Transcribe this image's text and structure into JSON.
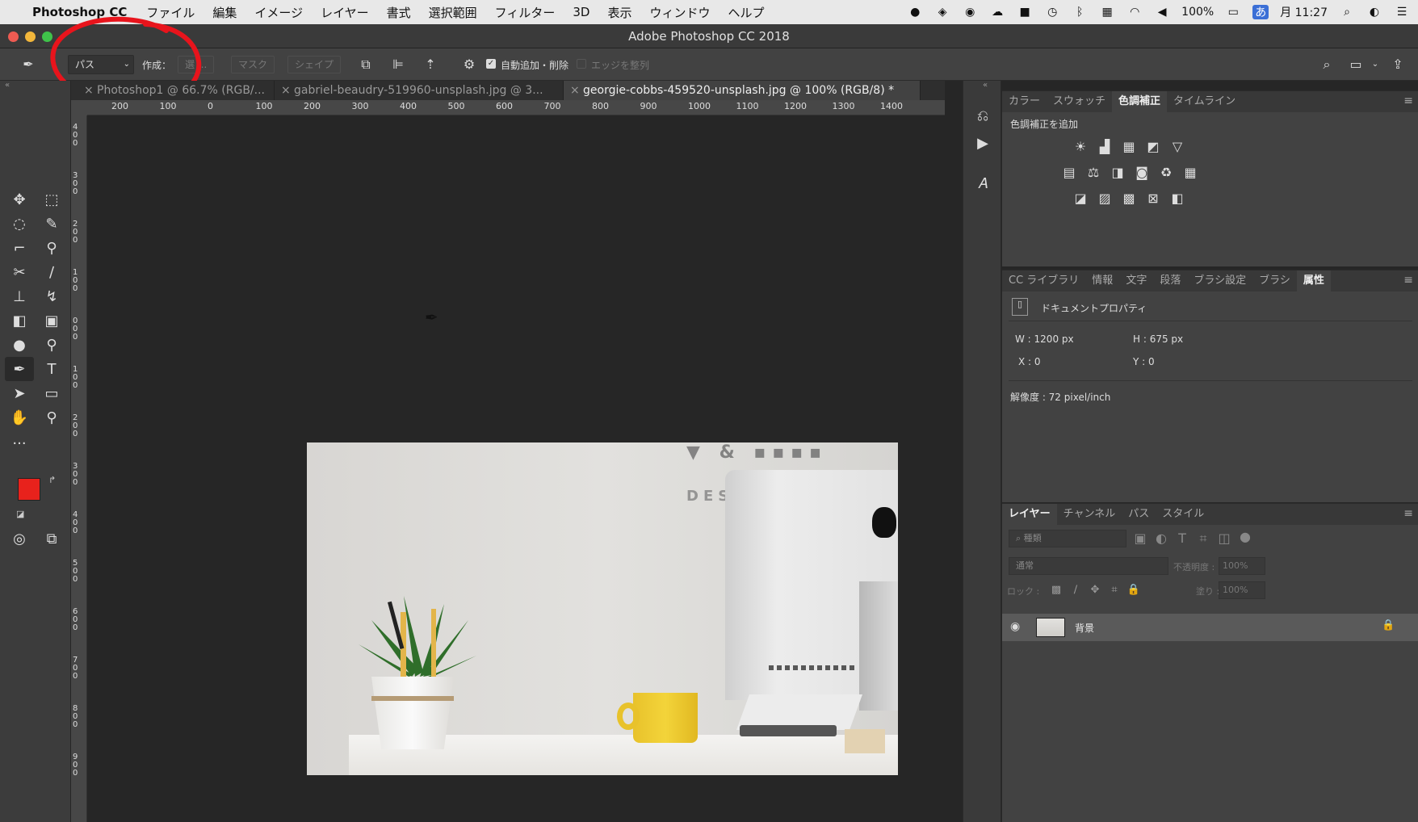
{
  "menubar": {
    "app_name": "Photoshop CC",
    "items": [
      "ファイル",
      "編集",
      "イメージ",
      "レイヤー",
      "書式",
      "選択範囲",
      "フィルター",
      "3D",
      "表示",
      "ウィンドウ",
      "ヘルプ"
    ],
    "battery": "100%",
    "clock": "月 11:27"
  },
  "window": {
    "title": "Adobe Photoshop CC 2018"
  },
  "options": {
    "mode_value": "パス",
    "make_label": "作成：",
    "make_button": "選 ...",
    "mask_button": "マスク",
    "shape_button": "シェイプ",
    "auto_add_delete_label": "自動追加・削除",
    "align_edges_label": "エッジを整列"
  },
  "tabs": [
    {
      "label": "Photoshop1 @ 66.7% (RGB/..."
    },
    {
      "label": "gabriel-beaudry-519960-unsplash.jpg @ 3..."
    },
    {
      "label": "georgie-cobbs-459520-unsplash.jpg @ 100% (RGB/8) *"
    }
  ],
  "ruler": {
    "h_ticks": [
      "200",
      "100",
      "0",
      "100",
      "200",
      "300",
      "400",
      "500",
      "600",
      "700",
      "800",
      "900",
      "1000",
      "1100",
      "1200",
      "1300",
      "1400"
    ],
    "v_ticks": [
      "4",
      "3",
      "2",
      "1",
      "0",
      "1",
      "2",
      "3",
      "4",
      "5",
      "6",
      "7",
      "8",
      "9"
    ]
  },
  "colors": {
    "foreground": "#e8221c",
    "background": "#ffffff",
    "annotation": "#e8141c"
  },
  "adjustments_panel": {
    "tabs": [
      "カラー",
      "スウォッチ",
      "色調補正",
      "タイムライン"
    ],
    "active": "色調補正",
    "header": "色調補正を追加"
  },
  "properties_panel": {
    "tabs": [
      "CC ライブラリ",
      "情報",
      "文字",
      "段落",
      "ブラシ設定",
      "ブラシ",
      "属性"
    ],
    "active": "属性",
    "doc_label": "ドキュメントプロパティ",
    "w": "W : 1200 px",
    "h": "H : 675 px",
    "x": "X : 0",
    "y": "Y : 0",
    "resolution": "解像度 : 72 pixel/inch"
  },
  "layers_panel": {
    "tabs": [
      "レイヤー",
      "チャンネル",
      "パス",
      "スタイル"
    ],
    "active": "レイヤー",
    "filter_placeholder": "種類",
    "blend_mode": "通常",
    "opacity_label": "不透明度 :",
    "opacity_value": "100%",
    "lock_label": "ロック :",
    "fill_label": "塗り :",
    "fill_value": "100%",
    "layers": [
      {
        "name": "背景",
        "locked": true
      }
    ]
  }
}
